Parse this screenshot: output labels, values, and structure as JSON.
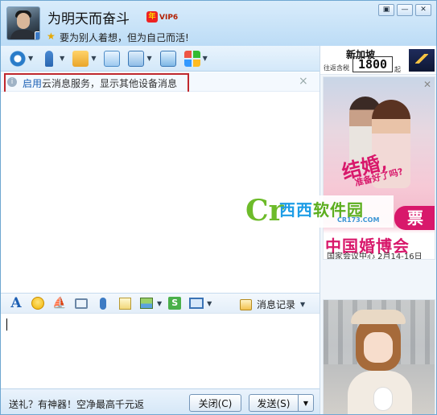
{
  "header": {
    "nickname": "为明天而奋斗",
    "vip_label": "VIP6",
    "vip_prefix": "年",
    "signature": "要为别人着想，但为自己而活!",
    "buttons": [
      "▣",
      "—",
      "✕"
    ]
  },
  "toolbar": {
    "items": [
      {
        "name": "video-call",
        "has_dropdown": true
      },
      {
        "name": "voice-call",
        "has_dropdown": true
      },
      {
        "name": "send-file",
        "has_dropdown": true
      },
      {
        "name": "create-discussion",
        "has_dropdown": false
      },
      {
        "name": "remote-desktop",
        "has_dropdown": true
      },
      {
        "name": "share-screen",
        "has_dropdown": false
      },
      {
        "name": "apps",
        "has_dropdown": true
      }
    ]
  },
  "notice": {
    "info_icon": "i",
    "enable_link": "启用",
    "message": "云消息服务，显示其他设备消息",
    "close": "×"
  },
  "input_toolbar": {
    "font_glyph": "A",
    "shake_glyph": "⛵",
    "screenshot_glyph": "S",
    "history_label": "消息记录",
    "dropdown_glyph": "▼"
  },
  "bottom": {
    "promo_text": "送礼？有神器！空净最高千元返",
    "close_button": "关闭(C)",
    "send_button": "发送(S)",
    "send_dropdown": "▼"
  },
  "ads": {
    "travel": {
      "destination": "新加坡",
      "from": "往返含税",
      "price": "1800",
      "suffix": "起"
    },
    "wedding": {
      "slogan_main": "结婚,",
      "slogan_sub": "准备好了吗?",
      "ticket": "票",
      "expo_title": "中国婚博会",
      "expo_info": "国家会议中心 2月14-16日"
    },
    "close_glyph": "✕"
  },
  "watermark": {
    "logo_letter": "Cr",
    "site_name_part1": "西西",
    "site_name_part2": "软件园",
    "url": "CR173.COM"
  },
  "colors": {
    "accent_blue": "#1a5fb4",
    "highlight_red": "#c0282d",
    "wedding_pink": "#d8186b"
  }
}
